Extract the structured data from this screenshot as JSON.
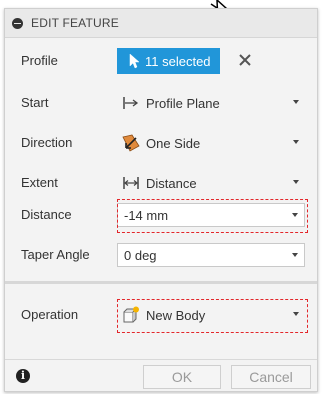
{
  "header": {
    "title": "EDIT FEATURE"
  },
  "rows": {
    "profile": {
      "label": "Profile",
      "value": "11 selected"
    },
    "start": {
      "label": "Start",
      "value": "Profile Plane"
    },
    "direction": {
      "label": "Direction",
      "value": "One Side"
    },
    "extent": {
      "label": "Extent",
      "value": "Distance"
    },
    "distance": {
      "label": "Distance",
      "value": "-14 mm"
    },
    "taper": {
      "label": "Taper Angle",
      "value": "0 deg"
    },
    "operation": {
      "label": "Operation",
      "value": "New Body"
    }
  },
  "footer": {
    "ok_label": "OK",
    "cancel_label": "Cancel"
  },
  "colors": {
    "accent": "#2196D9",
    "highlight_dash": "#E3262A"
  }
}
